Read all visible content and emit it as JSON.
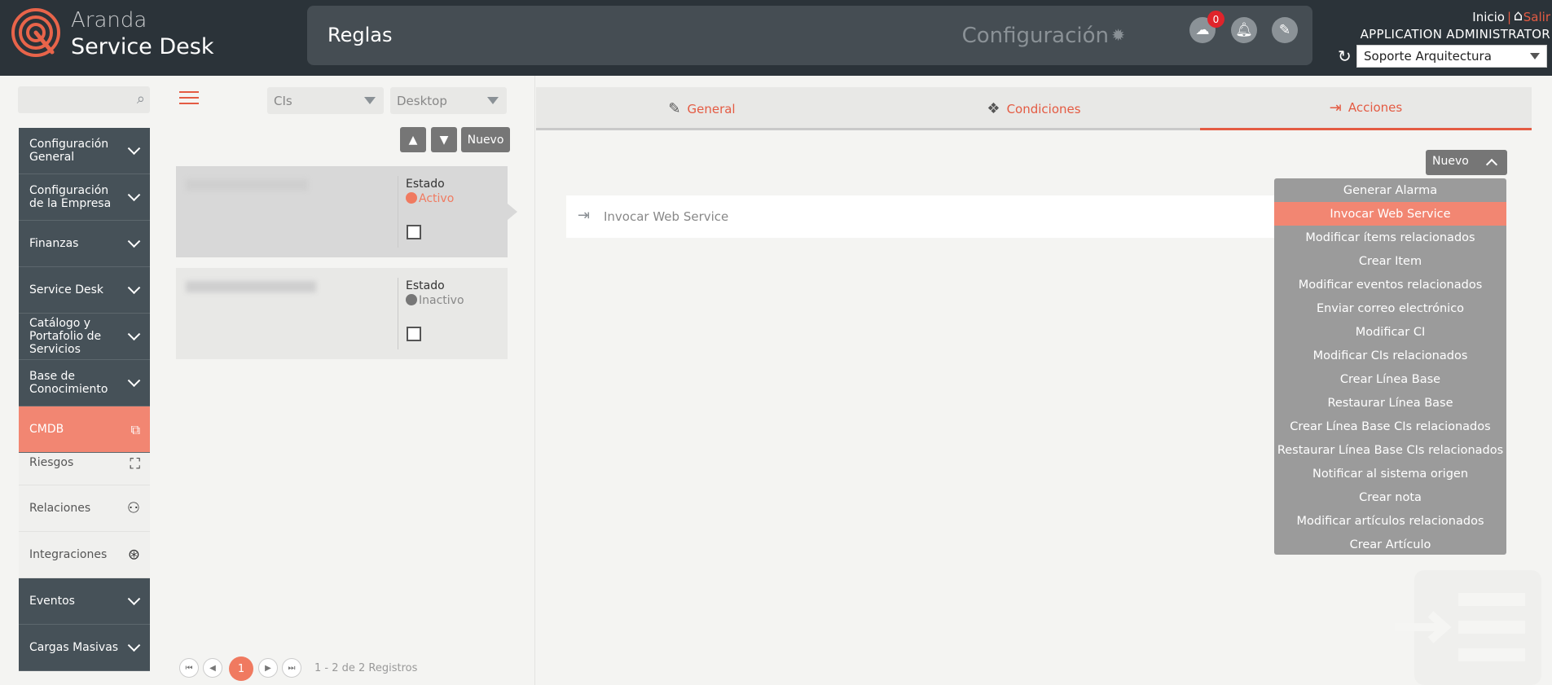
{
  "header": {
    "brand_line1": "Aranda",
    "brand_line2": "Service Desk",
    "page_title": "Reglas",
    "config_label": "Configuración",
    "notification_count": "0",
    "inicio": "Inicio",
    "separator": "|",
    "salir": "Salir",
    "user_name": "APPLICATION ADMINISTRATOR",
    "project": "Soporte Arquitectura"
  },
  "sidebar": {
    "search_placeholder": "",
    "items": [
      {
        "label": "Configuración General"
      },
      {
        "label": "Configuración de la Empresa"
      },
      {
        "label": "Finanzas"
      },
      {
        "label": "Service Desk"
      },
      {
        "label": "Catálogo y Portafolio de Servicios"
      },
      {
        "label": "Base de Conocimiento"
      },
      {
        "label": "CMDB"
      }
    ],
    "cmdb_sub": [
      {
        "label": "Riesgos",
        "icon": "barrier-icon"
      },
      {
        "label": "Relaciones",
        "icon": "relations-icon"
      },
      {
        "label": "Integraciones",
        "icon": "integration-icon"
      }
    ],
    "bottom_items": [
      {
        "label": "Eventos"
      },
      {
        "label": "Cargas Masivas"
      }
    ]
  },
  "list": {
    "filter_type": "CIs",
    "filter_subtype": "Desktop",
    "nuevo_label": "Nuevo",
    "records": [
      {
        "estado_label": "Estado",
        "status": "Activo",
        "status_color": "#f07a60"
      },
      {
        "estado_label": "Estado",
        "status": "Inactivo",
        "status_color": "#777777"
      }
    ],
    "pager": {
      "current_page": "1",
      "summary": "1 - 2 de 2 Registros"
    }
  },
  "detail": {
    "tabs": [
      {
        "label": "General",
        "icon": "edit-icon"
      },
      {
        "label": "Condiciones",
        "icon": "conditions-icon"
      },
      {
        "label": "Acciones",
        "icon": "actions-icon"
      }
    ],
    "active_tab": "Acciones",
    "nuevo_label": "Nuevo",
    "action_row_label": "Invocar Web Service",
    "dropdown_items": [
      "Generar Alarma",
      "Invocar Web Service",
      "Modificar ítems relacionados",
      "Crear Item",
      "Modificar eventos relacionados",
      "Enviar correo electrónico",
      "Modificar CI",
      "Modificar CIs relacionados",
      "Crear Línea Base",
      "Restaurar Línea Base",
      "Crear Línea Base CIs relacionados",
      "Restaurar Línea Base CIs relacionados",
      "Notificar al sistema origen",
      "Crear nota",
      "Modificar artículos relacionados",
      "Crear Artículo"
    ],
    "highlighted_item": "Invocar Web Service"
  },
  "colors": {
    "accent": "#e45b43",
    "header_bg": "#2b3339",
    "sidebar_bg": "#465158",
    "active_menu": "#f28672"
  }
}
